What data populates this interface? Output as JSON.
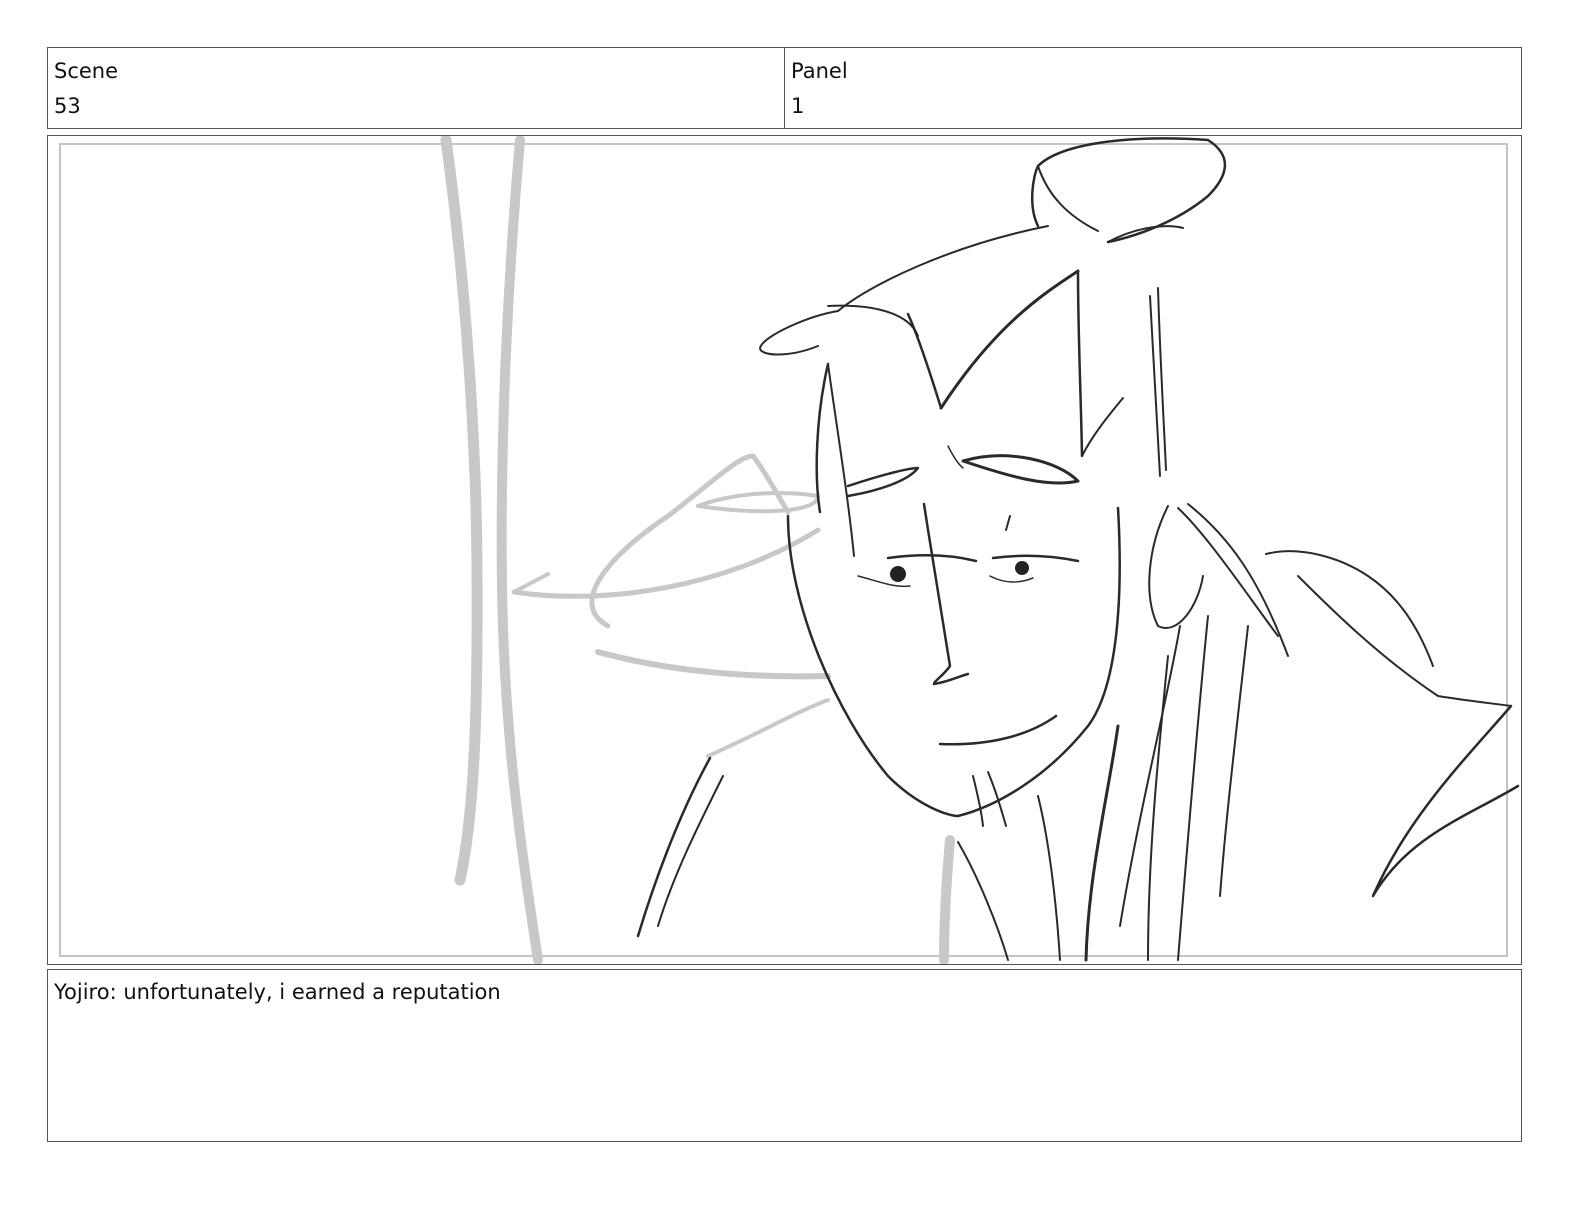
{
  "header": {
    "scene_label": "Scene",
    "scene_value": "53",
    "panel_label": "Panel",
    "panel_value": "1"
  },
  "frame": {
    "image_semantic": "storyboard-sketch-yojiro"
  },
  "caption": {
    "text": "Yojiro: unfortunately, i earned a reputation"
  }
}
